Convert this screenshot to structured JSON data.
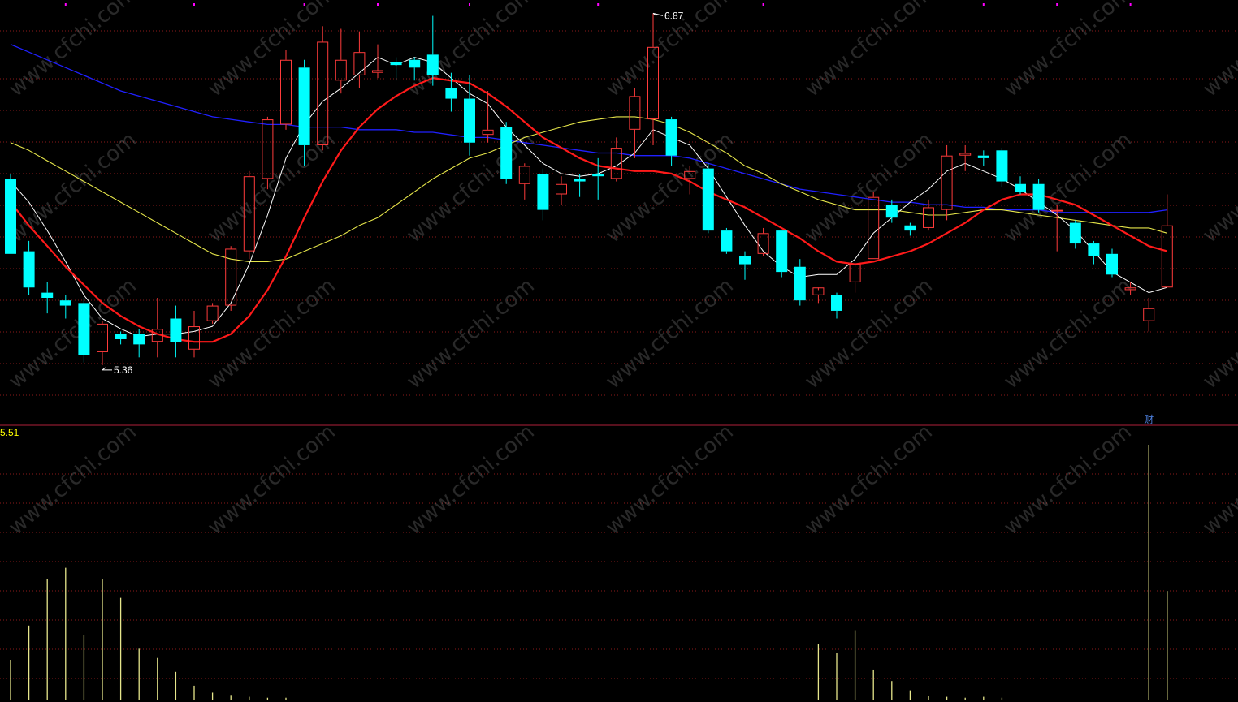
{
  "chart_data": {
    "type": "candlestick",
    "watermark": "www.cfchi.com",
    "colors": {
      "background": "#000000",
      "up": "#ff3b3b",
      "down": "#00ffff",
      "grid": "#8b1a1a",
      "separator": "#b0203a",
      "ma_white": "#ffffff",
      "ma_red": "#ff1a1a",
      "ma_yellow": "#e6e64a",
      "ma_blue": "#2020ff",
      "volume_line": "#e6e68c",
      "indicator_label": "#ffff00",
      "marker": "#ff00ff",
      "annotation": "#ffffff"
    },
    "price_axis": {
      "min": 5.3,
      "max": 6.9
    },
    "indicator_axis": {
      "min": 0,
      "max": 5.51
    },
    "annotations": {
      "high_label": "6.87",
      "low_label": "5.36",
      "event_label": "财",
      "indicator_value": "5.51"
    },
    "candles": [
      {
        "o": 6.24,
        "h": 6.26,
        "c": 5.95,
        "l": 5.95
      },
      {
        "o": 5.96,
        "h": 6.0,
        "c": 5.82,
        "l": 5.79
      },
      {
        "o": 5.8,
        "h": 5.84,
        "c": 5.78,
        "l": 5.72
      },
      {
        "o": 5.77,
        "h": 5.79,
        "c": 5.75,
        "l": 5.7
      },
      {
        "o": 5.76,
        "h": 5.78,
        "c": 5.56,
        "l": 5.53
      },
      {
        "o": 5.57,
        "h": 5.69,
        "c": 5.68,
        "l": 5.52
      },
      {
        "o": 5.64,
        "h": 5.65,
        "c": 5.62,
        "l": 5.6
      },
      {
        "o": 5.64,
        "h": 5.66,
        "c": 5.6,
        "l": 5.55
      },
      {
        "o": 5.61,
        "h": 5.78,
        "c": 5.66,
        "l": 5.55
      },
      {
        "o": 5.7,
        "h": 5.75,
        "c": 5.61,
        "l": 5.55
      },
      {
        "o": 5.58,
        "h": 5.73,
        "c": 5.67,
        "l": 5.55
      },
      {
        "o": 5.69,
        "h": 5.76,
        "c": 5.75,
        "l": 5.68
      },
      {
        "o": 5.75,
        "h": 5.98,
        "c": 5.97,
        "l": 5.73
      },
      {
        "o": 5.96,
        "h": 6.27,
        "c": 6.25,
        "l": 5.93
      },
      {
        "o": 6.24,
        "h": 6.48,
        "c": 6.47,
        "l": 6.2
      },
      {
        "o": 6.45,
        "h": 6.74,
        "c": 6.7,
        "l": 6.43
      },
      {
        "o": 6.67,
        "h": 6.7,
        "c": 6.37,
        "l": 6.29
      },
      {
        "o": 6.37,
        "h": 6.83,
        "c": 6.77,
        "l": 6.35
      },
      {
        "o": 6.62,
        "h": 6.82,
        "c": 6.7,
        "l": 6.57
      },
      {
        "o": 6.64,
        "h": 6.81,
        "c": 6.73,
        "l": 6.59
      },
      {
        "o": 6.65,
        "h": 6.76,
        "c": 6.66,
        "l": 6.63
      },
      {
        "o": 6.69,
        "h": 6.71,
        "c": 6.68,
        "l": 6.62
      },
      {
        "o": 6.7,
        "h": 6.71,
        "c": 6.67,
        "l": 6.62
      },
      {
        "o": 6.72,
        "h": 6.87,
        "c": 6.64,
        "l": 6.6
      },
      {
        "o": 6.59,
        "h": 6.65,
        "c": 6.55,
        "l": 6.5
      },
      {
        "o": 6.55,
        "h": 6.64,
        "c": 6.38,
        "l": 6.33
      },
      {
        "o": 6.41,
        "h": 6.58,
        "c": 6.43,
        "l": 6.38
      },
      {
        "o": 6.44,
        "h": 6.46,
        "c": 6.24,
        "l": 6.22
      },
      {
        "o": 6.22,
        "h": 6.3,
        "c": 6.29,
        "l": 6.16
      },
      {
        "o": 6.26,
        "h": 6.28,
        "c": 6.12,
        "l": 6.08
      },
      {
        "o": 6.18,
        "h": 6.25,
        "c": 6.22,
        "l": 6.14
      },
      {
        "o": 6.24,
        "h": 6.26,
        "c": 6.23,
        "l": 6.17
      },
      {
        "o": 6.26,
        "h": 6.32,
        "c": 6.25,
        "l": 6.16
      },
      {
        "o": 6.24,
        "h": 6.4,
        "c": 6.36,
        "l": 6.23
      },
      {
        "o": 6.43,
        "h": 6.59,
        "c": 6.56,
        "l": 6.32
      },
      {
        "o": 6.47,
        "h": 6.88,
        "c": 6.75,
        "l": 6.37
      },
      {
        "o": 6.47,
        "h": 6.48,
        "c": 6.33,
        "l": 6.29
      },
      {
        "o": 6.24,
        "h": 6.29,
        "c": 6.27,
        "l": 6.18
      },
      {
        "o": 6.28,
        "h": 6.3,
        "c": 6.04,
        "l": 6.03
      },
      {
        "o": 6.04,
        "h": 6.05,
        "c": 5.96,
        "l": 5.95
      },
      {
        "o": 5.94,
        "h": 5.96,
        "c": 5.91,
        "l": 5.85
      },
      {
        "o": 5.95,
        "h": 6.05,
        "c": 6.03,
        "l": 5.94
      },
      {
        "o": 6.04,
        "h": 6.04,
        "c": 5.88,
        "l": 5.86
      },
      {
        "o": 5.9,
        "h": 5.93,
        "c": 5.77,
        "l": 5.75
      },
      {
        "o": 5.79,
        "h": 5.81,
        "c": 5.82,
        "l": 5.76
      },
      {
        "o": 5.79,
        "h": 5.8,
        "c": 5.73,
        "l": 5.7
      },
      {
        "o": 5.84,
        "h": 5.9,
        "c": 5.91,
        "l": 5.8
      },
      {
        "o": 5.93,
        "h": 6.19,
        "c": 6.17,
        "l": 5.93
      },
      {
        "o": 6.14,
        "h": 6.16,
        "c": 6.09,
        "l": 6.07
      },
      {
        "o": 6.06,
        "h": 6.07,
        "c": 6.04,
        "l": 6.02
      },
      {
        "o": 6.05,
        "h": 6.16,
        "c": 6.13,
        "l": 6.04
      },
      {
        "o": 6.12,
        "h": 6.37,
        "c": 6.33,
        "l": 6.08
      },
      {
        "o": 6.33,
        "h": 6.37,
        "c": 6.34,
        "l": 6.27
      },
      {
        "o": 6.33,
        "h": 6.35,
        "c": 6.32,
        "l": 6.29
      },
      {
        "o": 6.35,
        "h": 6.36,
        "c": 6.23,
        "l": 6.21
      },
      {
        "o": 6.22,
        "h": 6.25,
        "c": 6.19,
        "l": 6.18
      },
      {
        "o": 6.22,
        "h": 6.24,
        "c": 6.12,
        "l": 6.11
      },
      {
        "o": 6.12,
        "h": 6.14,
        "c": 6.12,
        "l": 5.96
      },
      {
        "o": 6.07,
        "h": 6.08,
        "c": 5.99,
        "l": 5.97
      },
      {
        "o": 5.99,
        "h": 6.0,
        "c": 5.94,
        "l": 5.91
      },
      {
        "o": 5.95,
        "h": 5.97,
        "c": 5.87,
        "l": 5.86
      },
      {
        "o": 5.81,
        "h": 5.84,
        "c": 5.82,
        "l": 5.79
      },
      {
        "o": 5.69,
        "h": 5.78,
        "c": 5.74,
        "l": 5.65
      },
      {
        "o": 5.82,
        "h": 6.18,
        "c": 6.06,
        "l": 5.82
      }
    ],
    "ma_white": [
      6.23,
      6.15,
      6.04,
      5.92,
      5.79,
      5.7,
      5.66,
      5.63,
      5.64,
      5.64,
      5.65,
      5.67,
      5.76,
      5.91,
      6.1,
      6.32,
      6.45,
      6.54,
      6.59,
      6.65,
      6.71,
      6.68,
      6.71,
      6.69,
      6.63,
      6.57,
      6.53,
      6.44,
      6.37,
      6.3,
      6.26,
      6.25,
      6.26,
      6.29,
      6.34,
      6.43,
      6.4,
      6.37,
      6.28,
      6.17,
      6.06,
      5.96,
      5.9,
      5.86,
      5.87,
      5.87,
      5.93,
      6.03,
      6.09,
      6.15,
      6.2,
      6.27,
      6.3,
      6.27,
      6.24,
      6.2,
      6.15,
      6.1,
      6.04,
      5.96,
      5.88,
      5.84,
      5.8,
      5.82
    ],
    "ma_red": [
      6.15,
      6.06,
      5.98,
      5.9,
      5.83,
      5.76,
      5.71,
      5.67,
      5.64,
      5.62,
      5.61,
      5.61,
      5.64,
      5.71,
      5.81,
      5.94,
      6.09,
      6.23,
      6.35,
      6.44,
      6.51,
      6.56,
      6.6,
      6.63,
      6.62,
      6.61,
      6.57,
      6.52,
      6.46,
      6.4,
      6.36,
      6.32,
      6.29,
      6.28,
      6.27,
      6.27,
      6.26,
      6.23,
      6.19,
      6.16,
      6.13,
      6.09,
      6.05,
      6.01,
      5.96,
      5.92,
      5.91,
      5.92,
      5.94,
      5.96,
      5.99,
      6.03,
      6.07,
      6.12,
      6.16,
      6.18,
      6.18,
      6.16,
      6.14,
      6.1,
      6.06,
      6.02,
      5.98,
      5.96
    ],
    "ma_yellow": [
      6.38,
      6.35,
      6.31,
      6.27,
      6.23,
      6.19,
      6.15,
      6.11,
      6.07,
      6.03,
      5.99,
      5.95,
      5.93,
      5.92,
      5.92,
      5.93,
      5.96,
      5.99,
      6.02,
      6.06,
      6.09,
      6.14,
      6.19,
      6.24,
      6.28,
      6.32,
      6.34,
      6.37,
      6.4,
      6.42,
      6.44,
      6.46,
      6.47,
      6.48,
      6.48,
      6.47,
      6.45,
      6.42,
      6.38,
      6.34,
      6.29,
      6.26,
      6.22,
      6.19,
      6.16,
      6.14,
      6.12,
      6.12,
      6.12,
      6.11,
      6.1,
      6.1,
      6.11,
      6.12,
      6.12,
      6.11,
      6.1,
      6.09,
      6.08,
      6.07,
      6.06,
      6.05,
      6.05,
      6.03
    ],
    "ma_blue": [
      6.76,
      6.73,
      6.7,
      6.67,
      6.64,
      6.61,
      6.58,
      6.56,
      6.54,
      6.52,
      6.5,
      6.48,
      6.47,
      6.46,
      6.45,
      6.45,
      6.44,
      6.44,
      6.44,
      6.43,
      6.43,
      6.43,
      6.42,
      6.42,
      6.41,
      6.4,
      6.4,
      6.39,
      6.38,
      6.37,
      6.36,
      6.35,
      6.34,
      6.34,
      6.33,
      6.33,
      6.33,
      6.32,
      6.3,
      6.28,
      6.26,
      6.24,
      6.22,
      6.2,
      6.19,
      6.18,
      6.17,
      6.16,
      6.15,
      6.15,
      6.14,
      6.14,
      6.13,
      6.13,
      6.12,
      6.12,
      6.12,
      6.11,
      6.11,
      6.11,
      6.11,
      6.11,
      6.11,
      6.12
    ],
    "indicator_values": [
      0.86,
      1.6,
      2.6,
      2.85,
      1.4,
      2.6,
      2.2,
      1.1,
      0.9,
      0.6,
      0.3,
      0.15,
      0.1,
      0.06,
      0.04,
      0.04,
      0,
      0,
      0,
      0,
      0,
      0,
      0,
      0,
      0,
      0,
      0,
      0,
      0,
      0,
      0,
      0,
      0,
      0,
      0,
      0,
      0,
      0,
      0,
      0,
      0,
      0,
      0,
      0,
      1.2,
      1.0,
      1.5,
      0.65,
      0.4,
      0.2,
      0.08,
      0.06,
      0.04,
      0.06,
      0.04,
      0,
      0,
      0,
      0,
      0,
      0,
      0,
      5.51,
      2.35
    ],
    "markers_top": [
      3,
      10,
      16,
      20,
      25,
      32,
      41,
      53,
      57,
      61
    ]
  }
}
